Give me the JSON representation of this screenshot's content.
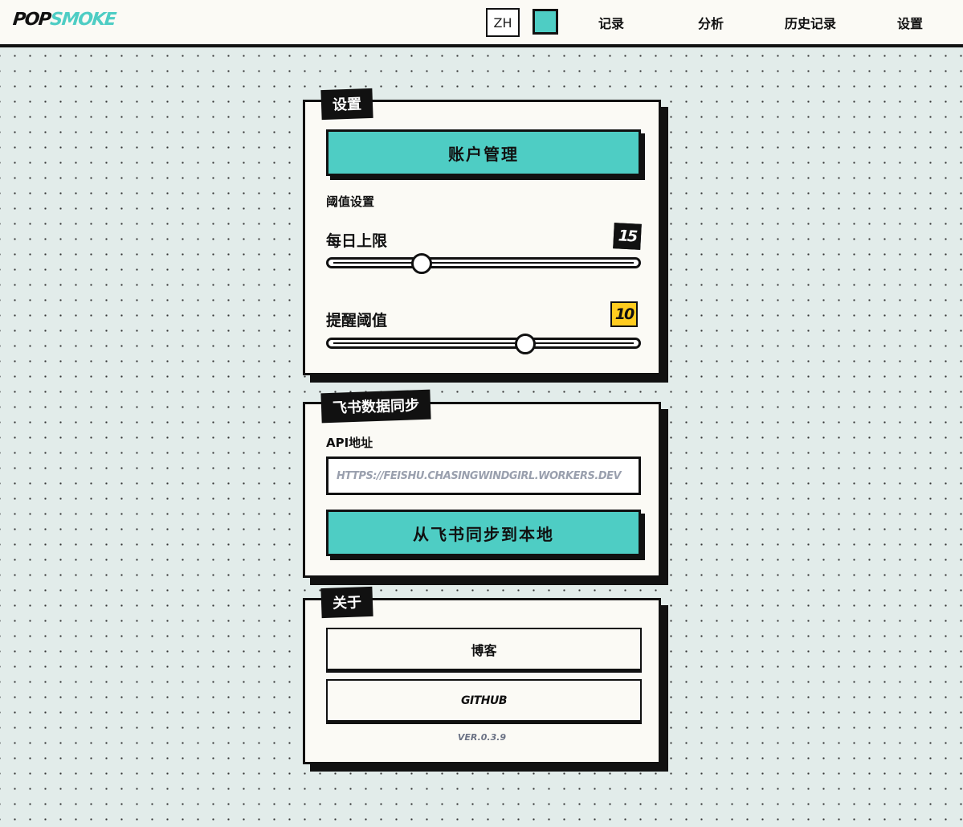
{
  "header": {
    "logo_pop": "POP",
    "logo_smoke": "SMOKE",
    "lang": "ZH",
    "nav": [
      {
        "label": "记录"
      },
      {
        "label": "分析"
      },
      {
        "label": "历史记录"
      },
      {
        "label": "设置"
      }
    ]
  },
  "colors": {
    "accent": "#4ecdc4",
    "badge_yellow": "#ffcc1f",
    "ink": "#111111",
    "paper": "#fbfaf5",
    "background": "#e2ecea"
  },
  "settings_card": {
    "tag": "设置",
    "account_button": "账户管理",
    "threshold_label": "阈值设置",
    "daily_limit": {
      "label": "每日上限",
      "value": "15",
      "fraction": 0.3
    },
    "reminder": {
      "label": "提醒阈值",
      "value": "10",
      "fraction": 0.635
    }
  },
  "sync_card": {
    "tag": "飞书数据同步",
    "api_label": "API地址",
    "api_placeholder": "https://feishu.chasingwindgirl.workers.dev",
    "sync_button": "从飞书同步到本地"
  },
  "about_card": {
    "tag": "关于",
    "blog_button": "博客",
    "github_button": "GitHub",
    "version": "Ver.0.3.9"
  }
}
